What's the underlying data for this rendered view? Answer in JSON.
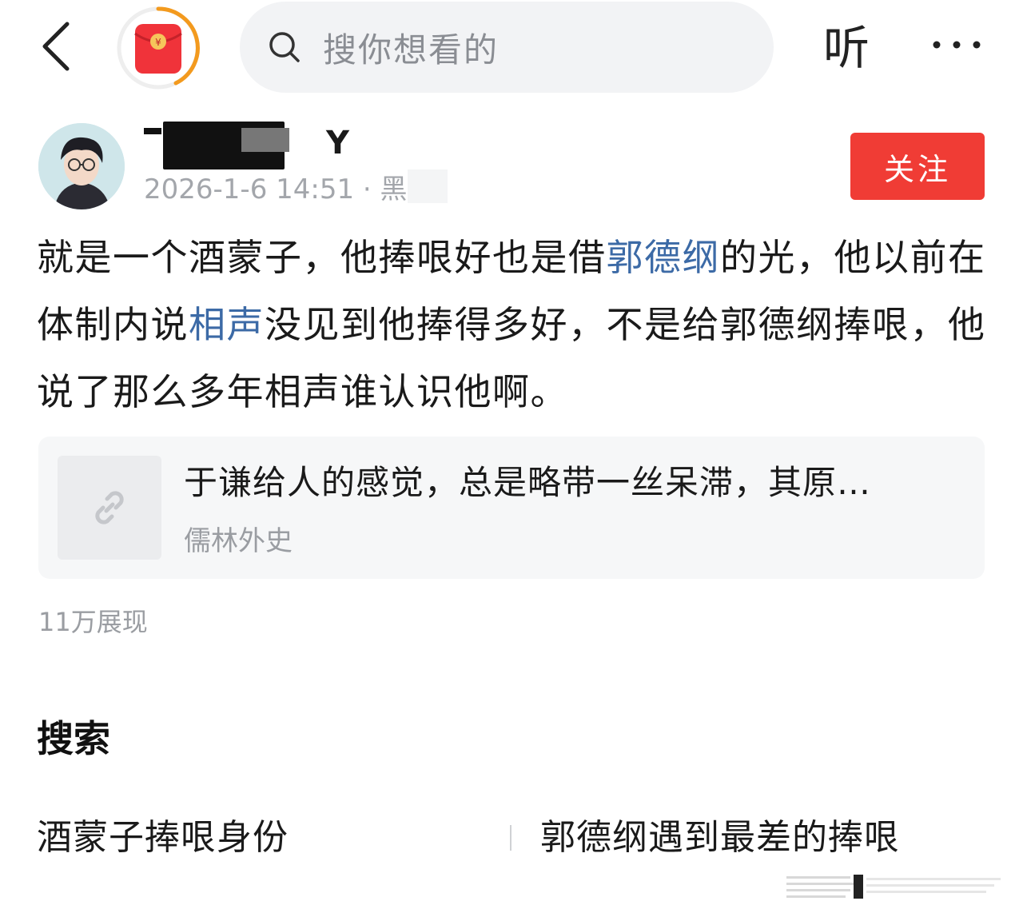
{
  "topbar": {
    "search_placeholder": "搜你想看的",
    "listen_label": "听"
  },
  "post": {
    "author_name": "Y",
    "meta": "2026-1-6 14:51 · 黑",
    "follow_label": "关注",
    "body": [
      {
        "text": "就是一个酒蒙子，他捧哏好也是借",
        "link": false
      },
      {
        "text": "郭德纲",
        "link": true
      },
      {
        "text": "的光，他以前在体制内说",
        "link": false
      },
      {
        "text": "相声",
        "link": true
      },
      {
        "text": "没见到他捧得多好，不是给郭德纲捧哏，他说了那么多年相声谁认识他啊。",
        "link": false
      }
    ],
    "link_card": {
      "title": "于谦给人的感觉，总是略带一丝呆滞，其原…",
      "source": "儒林外史"
    },
    "views": "11万展现"
  },
  "search_section": {
    "heading": "搜索",
    "suggestions": [
      "酒蒙子捧哏身份",
      "郭德纲遇到最差的捧哏"
    ]
  },
  "colors": {
    "accent_red": "#f03c35",
    "link_blue": "#3c6aa6",
    "search_bg": "#f2f3f5"
  }
}
